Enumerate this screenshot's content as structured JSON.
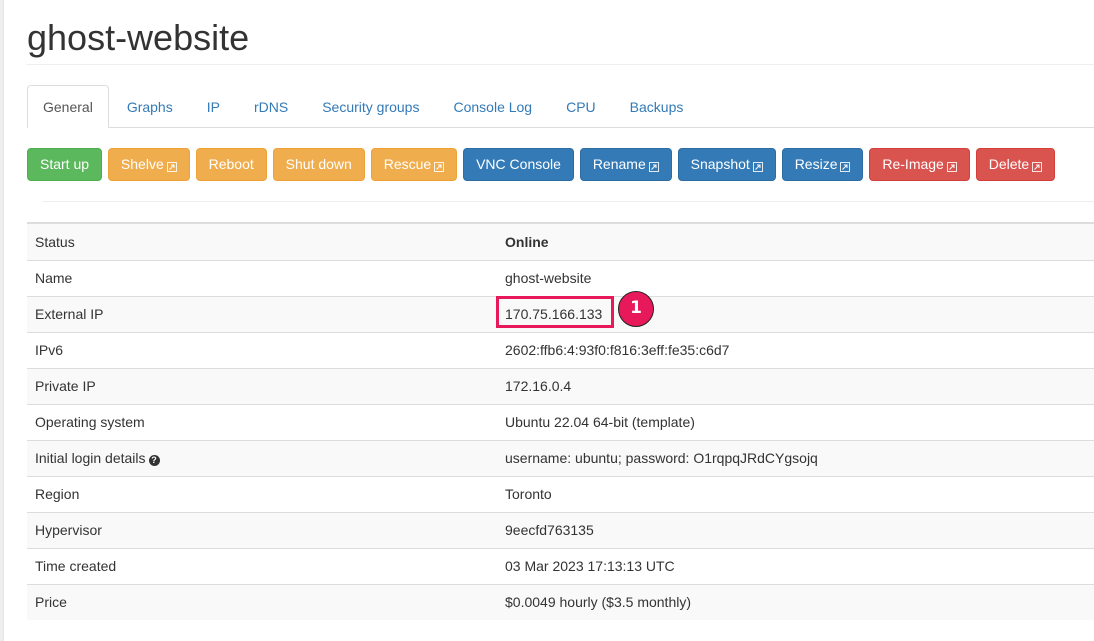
{
  "page": {
    "title": "ghost-website"
  },
  "tabs": [
    {
      "label": "General",
      "active": true
    },
    {
      "label": "Graphs"
    },
    {
      "label": "IP"
    },
    {
      "label": "rDNS"
    },
    {
      "label": "Security groups"
    },
    {
      "label": "Console Log"
    },
    {
      "label": "CPU"
    },
    {
      "label": "Backups"
    }
  ],
  "actions": [
    {
      "label": "Start up",
      "style": "success",
      "external": false
    },
    {
      "label": "Shelve",
      "style": "warning",
      "external": true
    },
    {
      "label": "Reboot",
      "style": "warning",
      "external": false
    },
    {
      "label": "Shut down",
      "style": "warning",
      "external": false
    },
    {
      "label": "Rescue",
      "style": "warning",
      "external": true
    },
    {
      "label": "VNC Console",
      "style": "primary",
      "external": false
    },
    {
      "label": "Rename",
      "style": "primary",
      "external": true
    },
    {
      "label": "Snapshot",
      "style": "primary",
      "external": true
    },
    {
      "label": "Resize",
      "style": "primary",
      "external": true
    },
    {
      "label": "Re-Image",
      "style": "danger",
      "external": true
    },
    {
      "label": "Delete",
      "style": "danger",
      "external": true
    }
  ],
  "details": {
    "status": {
      "label": "Status",
      "value": "Online",
      "color": "#008000"
    },
    "name": {
      "label": "Name",
      "value": "ghost-website"
    },
    "external_ip": {
      "label": "External IP",
      "value": "170.75.166.133"
    },
    "ipv6": {
      "label": "IPv6",
      "value": "2602:ffb6:4:93f0:f816:3eff:fe35:c6d7"
    },
    "private_ip": {
      "label": "Private IP",
      "value": "172.16.0.4"
    },
    "os": {
      "label": "Operating system",
      "value": "Ubuntu 22.04 64-bit (template)"
    },
    "login": {
      "label": "Initial login details",
      "value": "username: ubuntu; password: O1rqpqJRdCYgsojq",
      "help_icon": "question-circle-icon"
    },
    "region": {
      "label": "Region",
      "value": "Toronto"
    },
    "hypervisor": {
      "label": "Hypervisor",
      "value": "9eecfd763135"
    },
    "time_created": {
      "label": "Time created",
      "value": "03 Mar 2023 17:13:13 UTC"
    },
    "price": {
      "label": "Price",
      "value": "$0.0049 hourly ($3.5 monthly)"
    }
  },
  "annotation": {
    "number": "1",
    "target": "External IP value",
    "color": "#e8195a"
  },
  "colors": {
    "link": "#337ab7",
    "success": "#5cb85c",
    "warning": "#f0ad4e",
    "primary": "#337ab7",
    "danger": "#d9534f"
  }
}
